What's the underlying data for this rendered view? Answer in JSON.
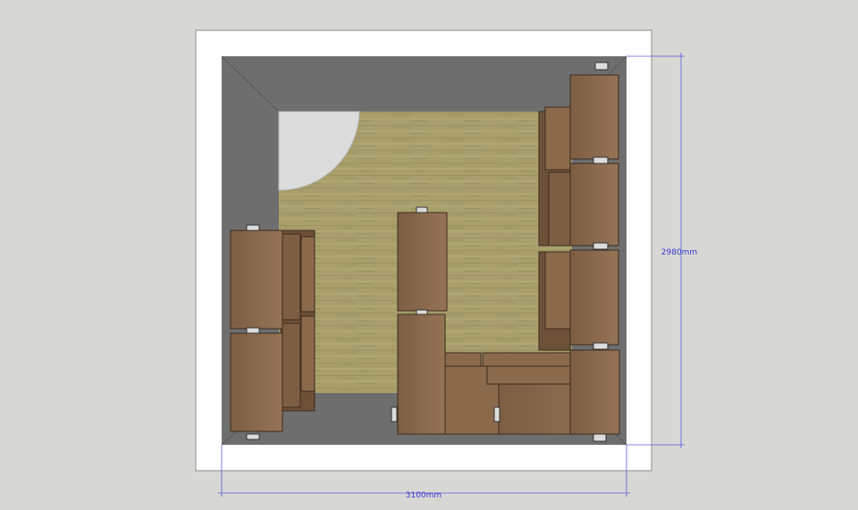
{
  "dimensions": {
    "width_label": "3100mm",
    "depth_label": "2980mm"
  },
  "colors": {
    "background": "#d7d8d3",
    "paper": "#ffffff",
    "wall": "#6e6e6e",
    "floor": "#a99f6c",
    "cabinet": "#8b6a4c",
    "dimension_line": "#5a5ae0"
  }
}
